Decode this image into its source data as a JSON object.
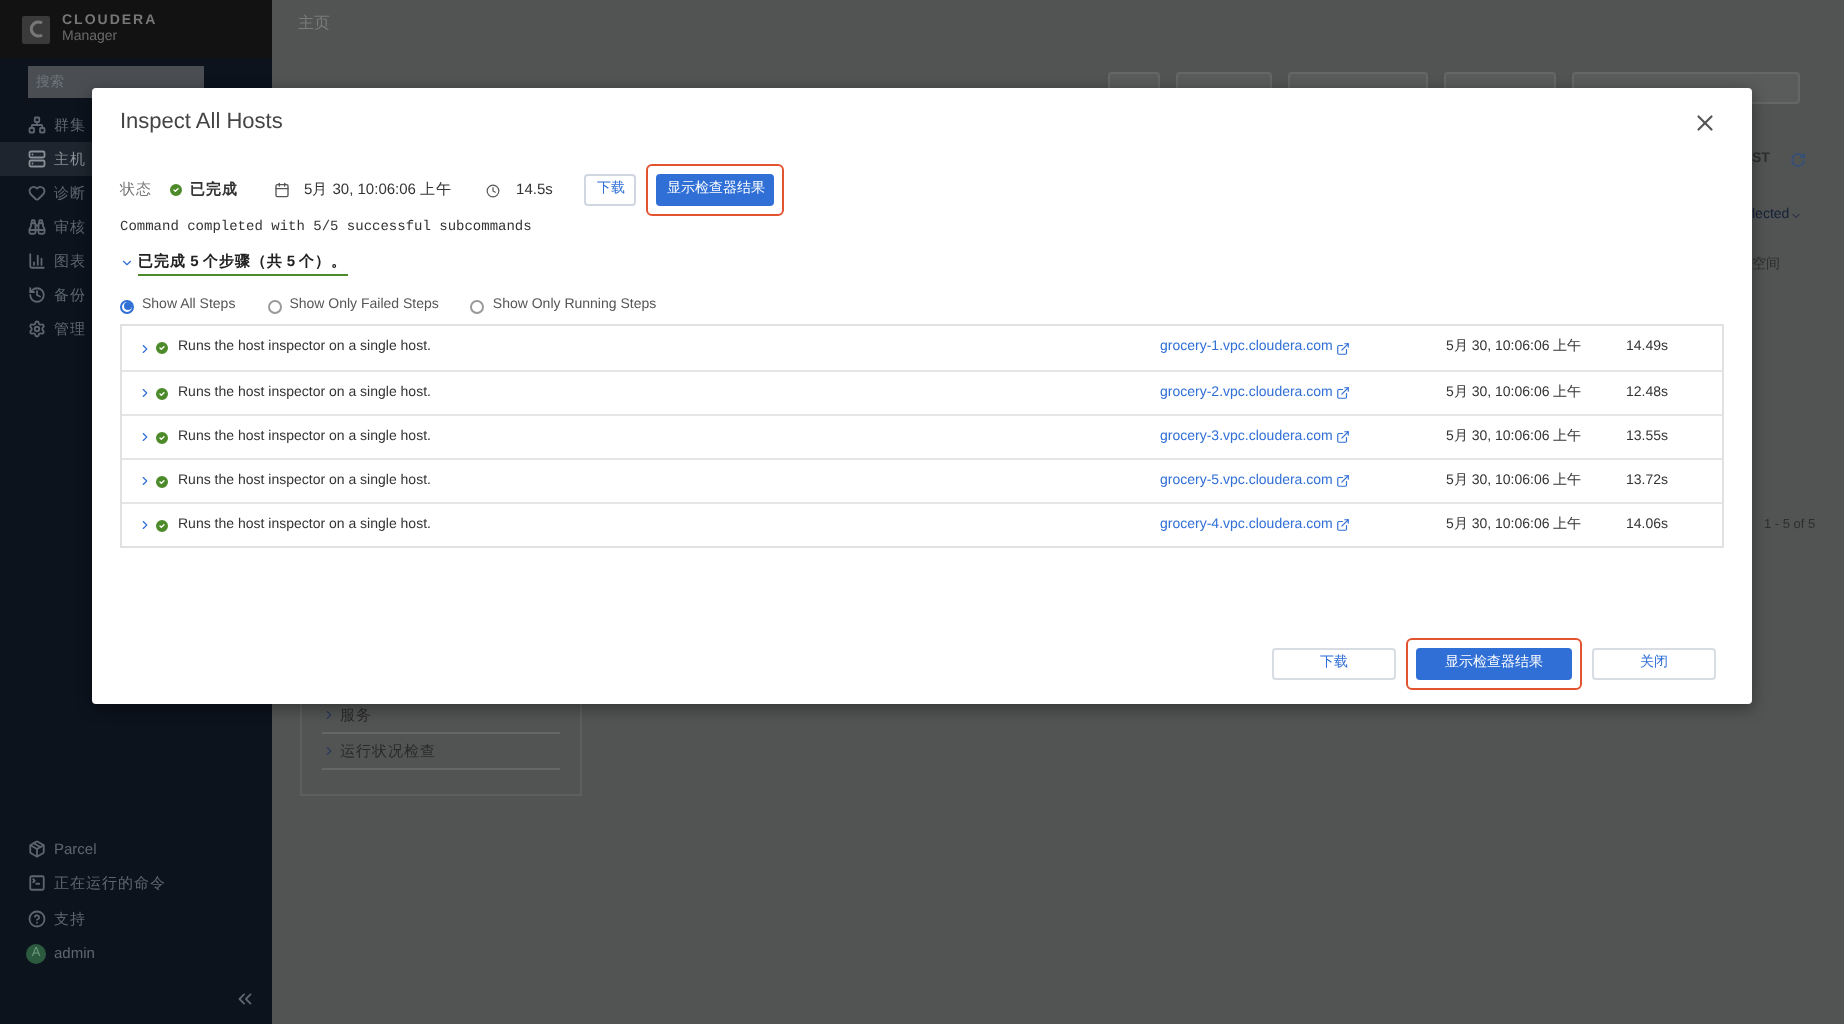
{
  "sidebar": {
    "logo": {
      "brand": "CLOUDERA",
      "product": "Manager"
    },
    "search": {
      "placeholder": "搜索"
    },
    "items": [
      {
        "label": "群集",
        "selected": false
      },
      {
        "label": "主机",
        "selected": true
      },
      {
        "label": "诊断",
        "selected": false
      },
      {
        "label": "审核",
        "selected": false
      },
      {
        "label": "图表",
        "selected": false
      },
      {
        "label": "备份",
        "selected": false
      },
      {
        "label": "管理",
        "selected": false
      }
    ],
    "footer_items": [
      {
        "label": "Parcel"
      },
      {
        "label": "正在运行的命令"
      },
      {
        "label": "支持"
      }
    ],
    "user": {
      "avatar": "A",
      "name": "admin"
    }
  },
  "page": {
    "breadcrumb": "主页",
    "side_panel": [
      "服务",
      "运行状况检查"
    ],
    "timezone": "ST",
    "filter": "lected",
    "column": "空间",
    "pager": "1 - 5 of 5"
  },
  "dialog": {
    "title": "Inspect All Hosts",
    "status": {
      "label": "状态",
      "value": "已完成",
      "date": "5月 30, 10:06:06 上午",
      "duration": "14.5s"
    },
    "top_buttons": [
      {
        "label": "下载",
        "kind": "secondary",
        "highlighted": false
      },
      {
        "label": "显示检查器结果",
        "kind": "primary",
        "highlighted": true
      }
    ],
    "message": "Command completed with 5/5 successful subcommands",
    "steps_toggle": {
      "label": "已完成 5 个步骤（共 5 个）。",
      "expanded": true
    },
    "filters": [
      {
        "label": "Show All Steps",
        "selected": true
      },
      {
        "label": "Show Only Failed Steps",
        "selected": false
      },
      {
        "label": "Show Only Running Steps",
        "selected": false
      }
    ],
    "steps": [
      {
        "description": "Runs the host inspector on a single host.",
        "host": "grocery-1.vpc.cloudera.com",
        "time": "5月 30, 10:06:06 上午",
        "duration": "14.49s"
      },
      {
        "description": "Runs the host inspector on a single host.",
        "host": "grocery-2.vpc.cloudera.com",
        "time": "5月 30, 10:06:06 上午",
        "duration": "12.48s"
      },
      {
        "description": "Runs the host inspector on a single host.",
        "host": "grocery-3.vpc.cloudera.com",
        "time": "5月 30, 10:06:06 上午",
        "duration": "13.55s"
      },
      {
        "description": "Runs the host inspector on a single host.",
        "host": "grocery-5.vpc.cloudera.com",
        "time": "5月 30, 10:06:06 上午",
        "duration": "13.72s"
      },
      {
        "description": "Runs the host inspector on a single host.",
        "host": "grocery-4.vpc.cloudera.com",
        "time": "5月 30, 10:06:06 上午",
        "duration": "14.06s"
      }
    ],
    "footer_buttons": [
      {
        "label": "下载",
        "kind": "secondary",
        "highlighted": false
      },
      {
        "label": "显示检查器结果",
        "kind": "primary",
        "highlighted": true
      },
      {
        "label": "关闭",
        "kind": "secondary",
        "highlighted": false
      }
    ]
  }
}
